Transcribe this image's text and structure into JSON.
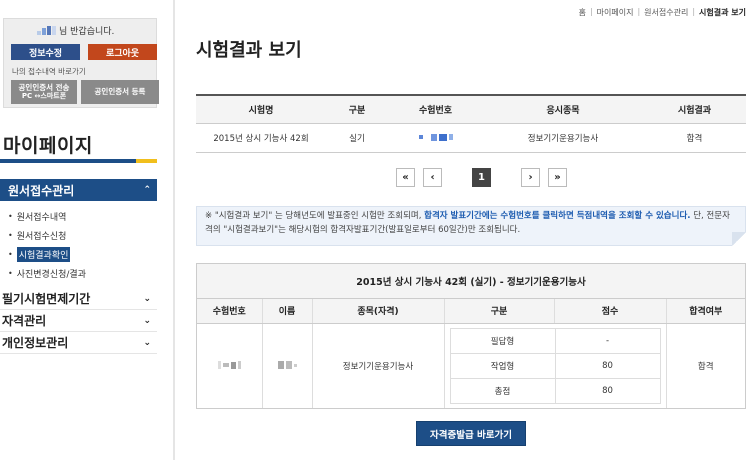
{
  "sidebar": {
    "greeting_suffix": "님 반갑습니다.",
    "edit_info_label": "정보수정",
    "logout_label": "로그아웃",
    "my_applications_link": "나의 접수내역 바로가기",
    "cert_transfer_label": "공인인증서 전송",
    "cert_transfer_sub": "PC ↔스마트폰",
    "cert_register_label": "공인인증서 등록",
    "mypage_title": "마이페이지",
    "active_menu": "원서접수관리",
    "sub_items": [
      "원서접수내역",
      "원서접수신청",
      "시험결과확인",
      "사진변경신청/결과"
    ],
    "active_sub_index": 2,
    "groups": [
      "필기시험면제기간",
      "자격관리",
      "개인정보관리"
    ],
    "colors": {
      "primary": "#1d4e87",
      "accent_yellow": "#f1bf1d",
      "logout_orange": "#c2471c"
    }
  },
  "breadcrumb": [
    "홈",
    "마이페이지",
    "원서접수관리",
    "시험결과 보기"
  ],
  "page_title": "시험결과 보기",
  "results_table": {
    "headers": [
      "시험명",
      "구분",
      "수험번호",
      "응시종목",
      "시험결과"
    ],
    "row": {
      "exam": "2015년 상시 기능사 42회",
      "type": "실기",
      "number": "",
      "subject": "정보기기운용기능사",
      "result": "합격"
    }
  },
  "pagination": {
    "first": "«",
    "prev": "‹",
    "page": "1",
    "next": "›",
    "last": "»"
  },
  "notice": {
    "prefix": "※ \"시험결과 보기\" 는 당해년도에 발표중인 시험만 조회되며, ",
    "highlight": "합격자 발표기간에는 수험번호를 클릭하면 득점내역을 조회할 수 있습니다.",
    "suffix": " 단, 전문자격의 \"시험결과보기\"는 해당시험의 합격자발표기간(발표일로부터 60일간)만 조회됩니다."
  },
  "detail": {
    "title": "2015년 상시 기능사 42회 (실기) - 정보기기운용기능사",
    "headers": [
      "수험번호",
      "이름",
      "종목(자격)",
      "구분",
      "점수",
      "합격여부"
    ],
    "subject": "정보기기운용기능사",
    "scores": [
      {
        "label": "필답형",
        "score": "-"
      },
      {
        "label": "작업형",
        "score": "80"
      },
      {
        "label": "총점",
        "score": "80"
      }
    ],
    "pass": "합격"
  },
  "cert_button_label": "자격증발급 바로가기"
}
